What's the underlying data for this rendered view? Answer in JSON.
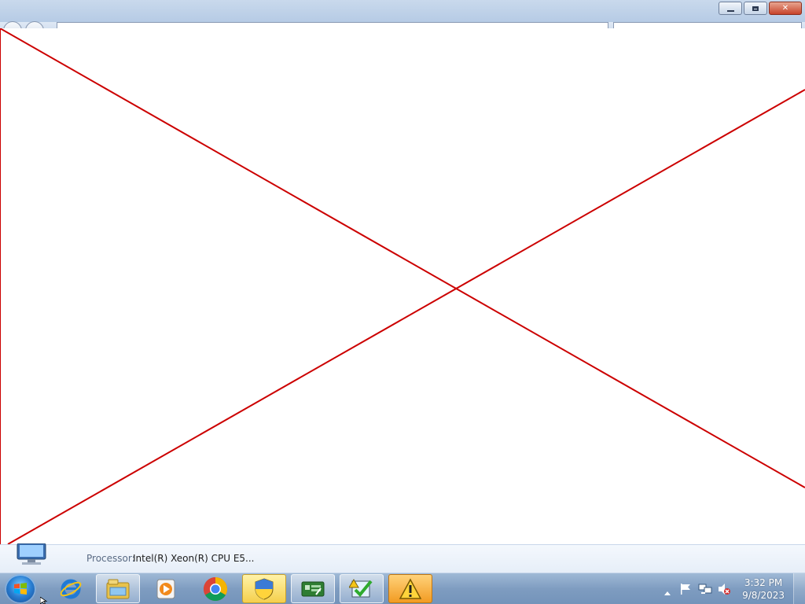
{
  "window": {
    "controls": {
      "minimize_icon": "minimize-icon",
      "restore_icon": "restore-icon",
      "close_icon": "close-icon"
    }
  },
  "content": {
    "state": "broken-render",
    "cross_color": "#cc0000"
  },
  "details_pane": {
    "processor_label": "Processor:",
    "processor_value": "Intel(R) Xeon(R) CPU E5..."
  },
  "taskbar": {
    "pinned": [
      {
        "name": "internet-explorer-icon"
      },
      {
        "name": "windows-explorer-icon"
      },
      {
        "name": "media-player-icon"
      },
      {
        "name": "chrome-icon"
      },
      {
        "name": "shield-icon"
      },
      {
        "name": "network-card-icon"
      },
      {
        "name": "checklist-icon"
      },
      {
        "name": "warning-icon"
      }
    ],
    "tray": {
      "show_hidden": "chevron-up-icon",
      "flag": "action-center-flag-icon",
      "network": "network-icon",
      "volume": "volume-muted-icon"
    },
    "clock": {
      "time": "3:32 PM",
      "date": "9/8/2023"
    }
  },
  "colors": {
    "taskbar": "#7e9cc0",
    "titlebar": "#c9d9ec",
    "cross": "#cc0000"
  }
}
